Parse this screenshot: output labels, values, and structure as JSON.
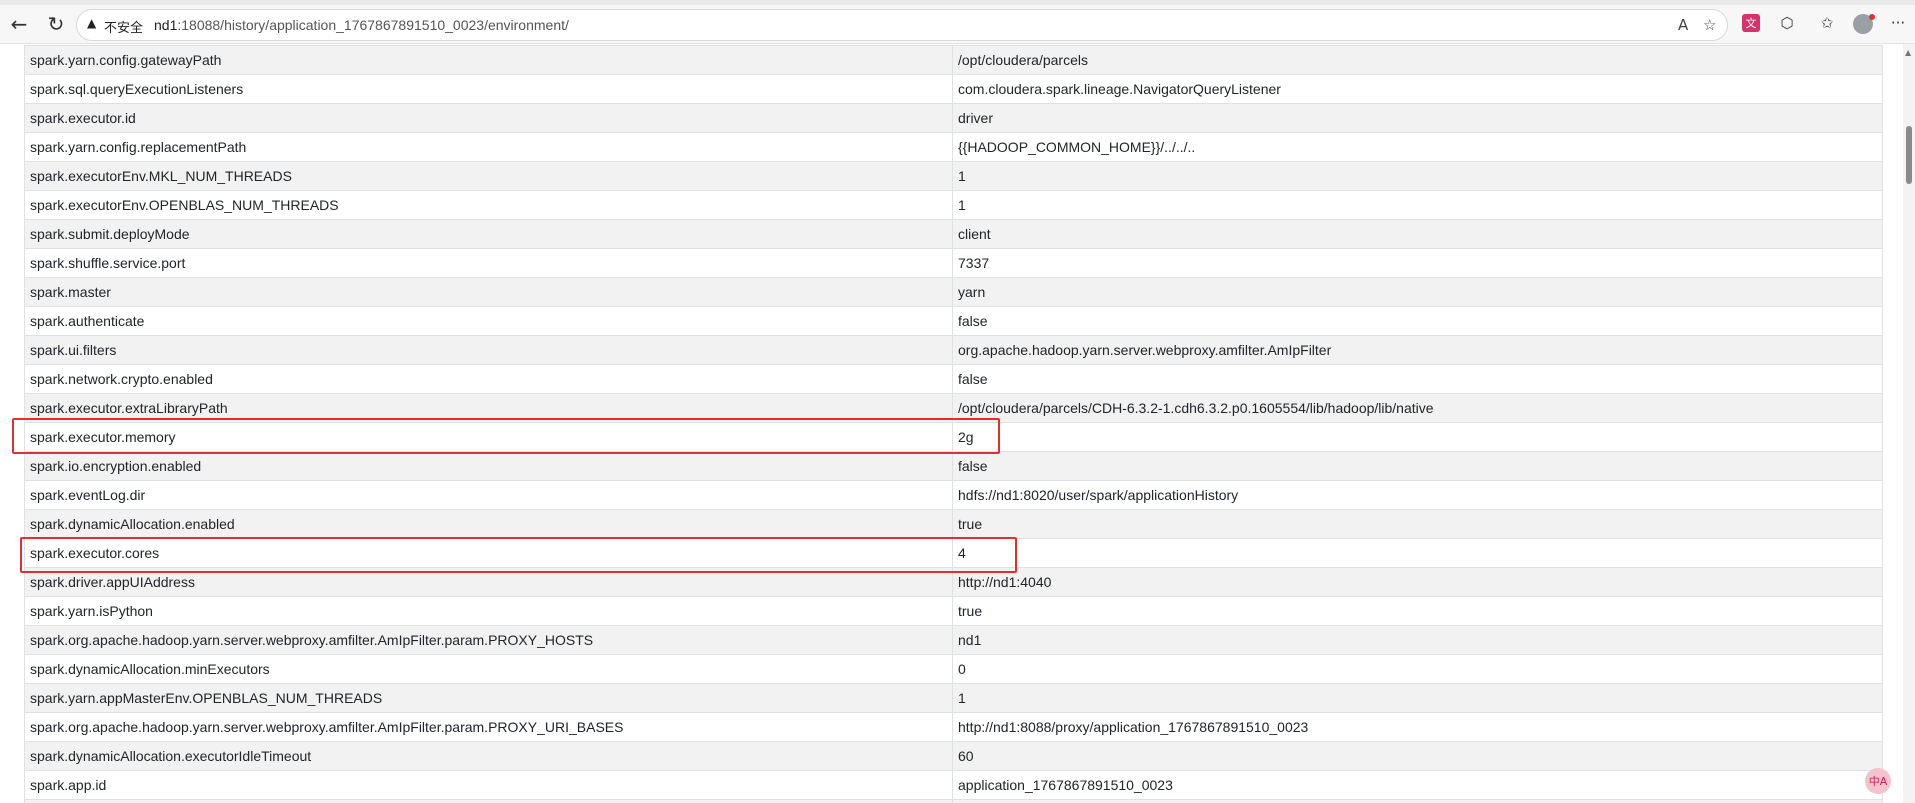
{
  "browser": {
    "security_label": "不安全",
    "url_host": "nd1",
    "url_rest": ":18088/history/application_1767867891510_0023/environment/",
    "icons": {
      "back": "back-arrow-icon",
      "refresh": "refresh-icon",
      "warning": "warning-icon",
      "read_aloud": "read-aloud-icon",
      "favorite": "star-icon",
      "translate": "translate-icon",
      "extensions": "extensions-icon",
      "favorites": "favorites-icon",
      "profile": "avatar",
      "menu": "more-icon"
    },
    "glyphs": {
      "back": "←",
      "refresh": "↻",
      "warning": "▲",
      "read_aloud": "A",
      "favorite": "☆",
      "translate": "文",
      "extensions": "⬡",
      "favorites": "✩",
      "menu": "···"
    },
    "floating_badge": "中A"
  },
  "properties": [
    {
      "name": "spark.yarn.config.gatewayPath",
      "value": "/opt/cloudera/parcels"
    },
    {
      "name": "spark.sql.queryExecutionListeners",
      "value": "com.cloudera.spark.lineage.NavigatorQueryListener"
    },
    {
      "name": "spark.executor.id",
      "value": "driver"
    },
    {
      "name": "spark.yarn.config.replacementPath",
      "value": "{{HADOOP_COMMON_HOME}}/../../.."
    },
    {
      "name": "spark.executorEnv.MKL_NUM_THREADS",
      "value": "1"
    },
    {
      "name": "spark.executorEnv.OPENBLAS_NUM_THREADS",
      "value": "1"
    },
    {
      "name": "spark.submit.deployMode",
      "value": "client"
    },
    {
      "name": "spark.shuffle.service.port",
      "value": "7337"
    },
    {
      "name": "spark.master",
      "value": "yarn"
    },
    {
      "name": "spark.authenticate",
      "value": "false"
    },
    {
      "name": "spark.ui.filters",
      "value": "org.apache.hadoop.yarn.server.webproxy.amfilter.AmIpFilter"
    },
    {
      "name": "spark.network.crypto.enabled",
      "value": "false"
    },
    {
      "name": "spark.executor.extraLibraryPath",
      "value": "/opt/cloudera/parcels/CDH-6.3.2-1.cdh6.3.2.p0.1605554/lib/hadoop/lib/native"
    },
    {
      "name": "spark.executor.memory",
      "value": "2g"
    },
    {
      "name": "spark.io.encryption.enabled",
      "value": "false"
    },
    {
      "name": "spark.eventLog.dir",
      "value": "hdfs://nd1:8020/user/spark/applicationHistory"
    },
    {
      "name": "spark.dynamicAllocation.enabled",
      "value": "true"
    },
    {
      "name": "spark.executor.cores",
      "value": "4"
    },
    {
      "name": "spark.driver.appUIAddress",
      "value": "http://nd1:4040"
    },
    {
      "name": "spark.yarn.isPython",
      "value": "true"
    },
    {
      "name": "spark.org.apache.hadoop.yarn.server.webproxy.amfilter.AmIpFilter.param.PROXY_HOSTS",
      "value": "nd1"
    },
    {
      "name": "spark.dynamicAllocation.minExecutors",
      "value": "0"
    },
    {
      "name": "spark.yarn.appMasterEnv.OPENBLAS_NUM_THREADS",
      "value": "1"
    },
    {
      "name": "spark.org.apache.hadoop.yarn.server.webproxy.amfilter.AmIpFilter.param.PROXY_URI_BASES",
      "value": "http://nd1:8088/proxy/application_1767867891510_0023"
    },
    {
      "name": "spark.dynamicAllocation.executorIdleTimeout",
      "value": "60"
    },
    {
      "name": "spark.app.id",
      "value": "application_1767867891510_0023"
    },
    {
      "name": "",
      "value": ""
    }
  ],
  "highlighted_properties": [
    "spark.executor.memory",
    "spark.executor.cores"
  ],
  "colors": {
    "highlight": "#e03131",
    "row_stripe": "#f2f2f2",
    "border": "#dee2e6"
  }
}
